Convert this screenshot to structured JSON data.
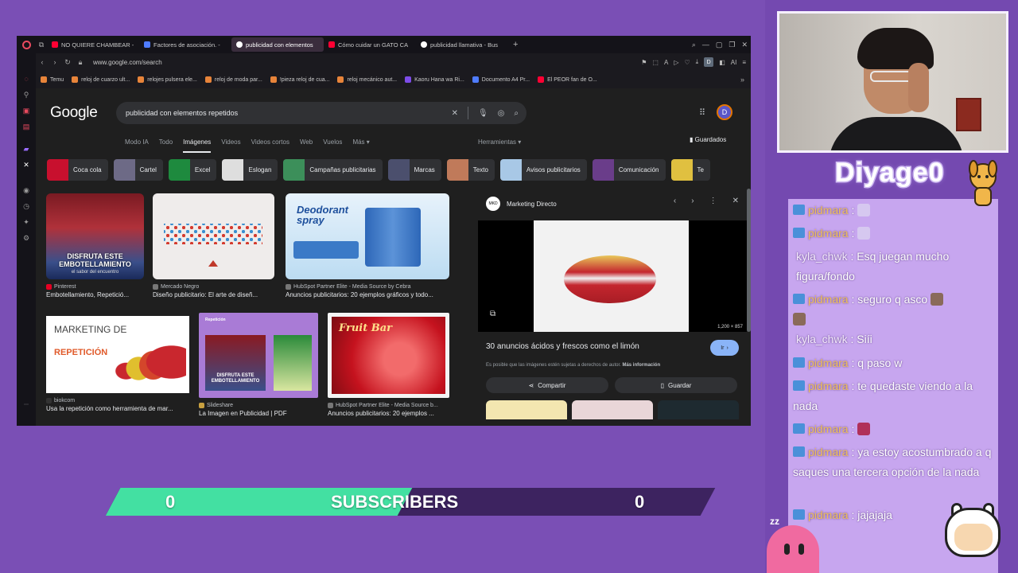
{
  "browser": {
    "tabs": [
      {
        "label": "NO QUIERE CHAMBEAR -",
        "color": "#ff0033"
      },
      {
        "label": "Factores de asociación. -",
        "color": "#4f7cff"
      },
      {
        "label": "publicidad con elementos",
        "color": "#ffffff",
        "active": true
      },
      {
        "label": "Cómo cuidar un GATO CA",
        "color": "#ff0033"
      },
      {
        "label": "publicidad llamativa - Bus",
        "color": "#ffffff"
      }
    ],
    "url": "www.google.com/search",
    "profile_initial": "D",
    "ai_label": "AI",
    "bookmarks": [
      "Temu",
      "reloj de cuarzo ult...",
      "relojes pulsera ele...",
      "reloj de moda par...",
      "!pieza reloj de cua...",
      "reloj mecánico aut...",
      "Kaoru Hana wa Ri...",
      "Documento A4 Pr...",
      "El PEOR fan de O..."
    ]
  },
  "google": {
    "logo": "Google",
    "query": "publicidad con elementos repetidos",
    "profile_initial": "D",
    "tabs": [
      "Modo IA",
      "Todo",
      "Imágenes",
      "Videos",
      "Videos cortos",
      "Web",
      "Vuelos",
      "Más"
    ],
    "active_tab": "Imágenes",
    "herramientas": "Herramientas",
    "guardados": "Guardados",
    "chips": [
      {
        "label": "Coca cola",
        "color": "#c8102e"
      },
      {
        "label": "Cartel",
        "color": "#6d6a86"
      },
      {
        "label": "Excel",
        "color": "#1e8a3e"
      },
      {
        "label": "Eslogan",
        "color": "#dedede"
      },
      {
        "label": "Campañas publicitarias",
        "color": "#3c8f5a"
      },
      {
        "label": "Marcas",
        "color": "#4b4f6d"
      },
      {
        "label": "Texto",
        "color": "#c07a5a"
      },
      {
        "label": "Avisos publicitarios",
        "color": "#a8c8e6"
      },
      {
        "label": "Comunicación",
        "color": "#6a3d8a"
      },
      {
        "label": "Te",
        "color": "#e0c040"
      }
    ],
    "results": [
      {
        "source": "Pinterest",
        "title": "Embotellamiento, Repetició...",
        "caption": "DISFRUTA ESTE EMBOTELLAMIENTO",
        "subcaption": "el sabor del encuentro"
      },
      {
        "source": "Mercado Negro",
        "title": "Diseño publicitario: El arte de diseñ..."
      },
      {
        "source": "HubSpot Partner Elite - Media Source by Cebra",
        "title": "Anuncios publicitarios: 20 ejemplos gráficos y todo...",
        "caption": "Deodorant spray"
      },
      {
        "source": "biokcom",
        "title": "Usa la repetición como herramienta de mar...",
        "caption": "MARKETING DE",
        "caption2": "REPETICIÓN"
      },
      {
        "source": "Slideshare",
        "title": "La Imagen en Publicidad | PDF",
        "caption": "Repetición",
        "caption2": "DISFRUTA ESTE EMBOTELLAMIENTO"
      },
      {
        "source": "HubSpot Partner Elite - Media Source b...",
        "title": "Anuncios publicitarios: 20 ejemplos ...",
        "caption": "Fruit Bar"
      }
    ],
    "panel": {
      "site": "Marketing Directo",
      "site_logo": "MKD",
      "dimensions": "1,200 × 857",
      "title": "30 anuncios ácidos y frescos como el limón",
      "go_label": "Ir",
      "disclaimer": "Es posible que las imágenes estén sujetas a derechos de autor.",
      "more_info": "Más información",
      "share_label": "Compartir",
      "save_label": "Guardar"
    }
  },
  "subscribers": {
    "left_count": "0",
    "label": "SUBSCRIBERS",
    "right_count": "0",
    "progress_fraction": 0.49
  },
  "stream": {
    "streamer_name": "Diyage0",
    "chat": [
      {
        "user": "pidmara",
        "text": "",
        "badge": true,
        "emote": "#d6c8f0"
      },
      {
        "user": "pidmara",
        "text": "",
        "badge": true,
        "emote": "#d6c8f0"
      },
      {
        "user": "kyla_chwk",
        "text": "Esq juegan mucho figura/fondo",
        "badge": false
      },
      {
        "user": "pidmara",
        "text": "seguro q asco",
        "badge": true,
        "emote": "#8a6a5a"
      },
      {
        "user": "kyla_chwk",
        "text": "Siíi",
        "badge": false
      },
      {
        "user": "pidmara",
        "text": "q paso w",
        "badge": true
      },
      {
        "user": "pidmara",
        "text": "te quedaste viendo a la nada",
        "badge": true
      },
      {
        "user": "pidmara",
        "text": "",
        "badge": true,
        "emote": "#b0305a"
      },
      {
        "user": "pidmara",
        "text": "ya estoy acostumbrado a q saques una tercera opción de la nada",
        "badge": true
      },
      {
        "user": "pidmara",
        "text": "jajajaja",
        "badge": true
      }
    ]
  },
  "colors": {
    "stream_bg": "#7a4fb5",
    "chat_bg": "#c7a6ef",
    "subbar_fill": "#43e0a2",
    "subbar_bg": "#3d2360",
    "username": "#f0c05a",
    "google_accent": "#8ab4f8"
  }
}
